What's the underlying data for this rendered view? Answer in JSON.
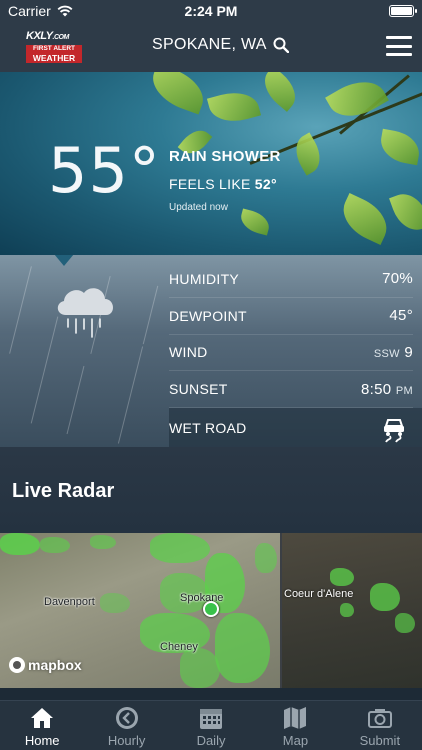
{
  "status": {
    "carrier": "Carrier",
    "time": "2:24 PM",
    "battery_level": 1.0
  },
  "header": {
    "logo": {
      "line1": "KXLY",
      "line1_suffix": ".COM",
      "line2": "FIRST ALERT",
      "line3": "WEATHER"
    },
    "location": "SPOKANE, WA"
  },
  "current": {
    "temperature": "55°",
    "condition": "RAIN SHOWER",
    "feels_like_label": "FEELS LIKE",
    "feels_like_value": "52°",
    "updated": "Updated now"
  },
  "details": [
    {
      "label": "HUMIDITY",
      "value": "70%",
      "unit": ""
    },
    {
      "label": "DEWPOINT",
      "value": "45°",
      "unit": ""
    },
    {
      "label": "WIND",
      "dir": "SSW",
      "value": "9"
    },
    {
      "label": "SUNSET",
      "value": "8:50",
      "unit": "PM"
    },
    {
      "label": "WET ROAD",
      "icon": "slippery-road-icon"
    }
  ],
  "radar": {
    "title": "Live Radar",
    "towns": [
      "Davenport",
      "Spokane",
      "Coeur d'Alene",
      "Cheney"
    ],
    "attribution": "mapbox"
  },
  "tabs": [
    {
      "label": "Home",
      "icon": "home-icon",
      "active": true
    },
    {
      "label": "Hourly",
      "icon": "clock-back-icon",
      "active": false
    },
    {
      "label": "Daily",
      "icon": "calendar-icon",
      "active": false
    },
    {
      "label": "Map",
      "icon": "map-icon",
      "active": false
    },
    {
      "label": "Submit",
      "icon": "camera-icon",
      "active": false
    }
  ],
  "colors": {
    "header_bg": "#2e3b48",
    "logo_red": "#c3272b",
    "radar_green": "#5bd14a",
    "tab_active": "#ffffff",
    "tab_inactive": "#9aa5ae"
  }
}
